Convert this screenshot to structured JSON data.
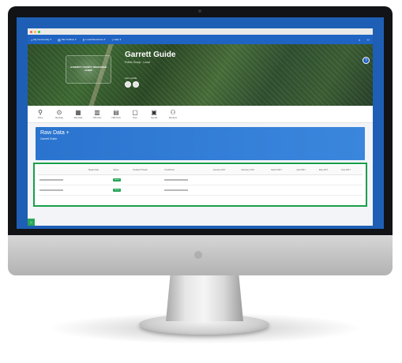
{
  "window": {
    "dot_colors": [
      "#ff5f57",
      "#febc2e",
      "#28c840"
    ]
  },
  "topnav": {
    "items": [
      {
        "icon": "home-icon",
        "label": "My Community"
      },
      {
        "icon": "book-icon",
        "label": "Site Toolbox"
      },
      {
        "icon": "pin-icon",
        "label": "Local Resources"
      },
      {
        "icon": "help-icon",
        "label": "Help"
      }
    ]
  },
  "hero": {
    "logo_text": "GARRETT COUNTY RECHARGE GUIDE",
    "title": "Garrett Guide",
    "subtitle": "Public Group · Local",
    "join_text": "Join in profile",
    "help_glyph": "?"
  },
  "toolbar": {
    "tools": [
      {
        "icon": "pin-icon",
        "glyph": "⚲",
        "label": "Home"
      },
      {
        "icon": "meetings-icon",
        "glyph": "⊙",
        "label": "Meetings"
      },
      {
        "icon": "table-icon",
        "glyph": "▦",
        "label": "Raw Data"
      },
      {
        "icon": "chart-icon",
        "glyph": "▥",
        "label": "CRS & Ex"
      },
      {
        "icon": "map-icon",
        "glyph": "▤",
        "label": "CRM Tools"
      },
      {
        "icon": "document-icon",
        "glyph": "▢",
        "label": "Docs"
      },
      {
        "icon": "agenda-icon",
        "glyph": "▣",
        "label": "Agenda"
      },
      {
        "icon": "members-icon",
        "glyph": "⚇",
        "label": "Members"
      }
    ]
  },
  "raw_data": {
    "title": "Raw Data +",
    "subtitle": "Garrett Guide"
  },
  "table": {
    "headers": [
      "",
      "Target Date",
      "Status",
      "Related Thread",
      "Contributor",
      "January 2017",
      "February 2017",
      "March 2017",
      "April 2017",
      "May 2017",
      "June 2017"
    ],
    "rows": [
      {
        "target": "",
        "status": "Active",
        "thread": "",
        "contributor": "",
        "months": [
          "",
          "",
          "",
          "",
          "",
          ""
        ]
      },
      {
        "target": "",
        "status": "Active",
        "thread": "",
        "contributor": "",
        "months": [
          "",
          "",
          "",
          "",
          "",
          ""
        ]
      }
    ]
  },
  "side_tab_glyph": "⌂"
}
